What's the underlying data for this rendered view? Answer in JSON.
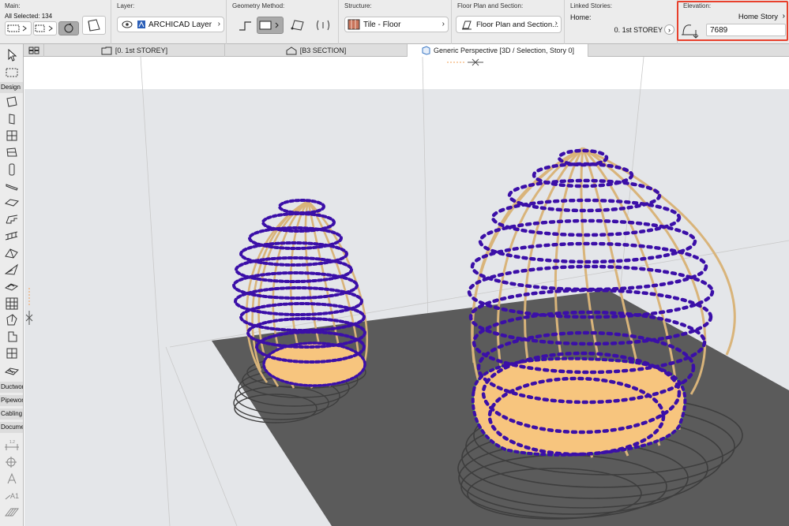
{
  "infobox": {
    "main": {
      "title": "Main:",
      "selection_label": "All Selected: 134"
    },
    "layer": {
      "title": "Layer:",
      "value": "ARCHICAD Layer"
    },
    "geometry": {
      "title": "Geometry Method:"
    },
    "structure": {
      "title": "Structure:",
      "value": "Tile - Floor"
    },
    "floor_plan": {
      "title": "Floor Plan and Section:",
      "value": "Floor Plan and Section..."
    },
    "linked": {
      "title": "Linked Stories:",
      "home_label": "Home:",
      "home_value": "0. 1st STOREY"
    },
    "elevation": {
      "title": "Elevation:",
      "reference": "Home Story",
      "value": "7689"
    }
  },
  "tabs": [
    {
      "label": "[0. 1st STOREY]"
    },
    {
      "label": "[B3 SECTION]"
    },
    {
      "label": "Generic Perspective [3D / Selection, Story 0]"
    }
  ],
  "toolbox": {
    "groups": {
      "design": "Design",
      "ductwork": "Ductwork",
      "pipework": "Pipework",
      "cabling": "Cabling",
      "document": "Document"
    }
  },
  "colors": {
    "selection_points": "#3b0fa8",
    "structure_tan": "#d9b47a",
    "floor_fill": "#f7c57e",
    "ground_slab": "#5b5b5b",
    "highlight": "#e8402c"
  }
}
